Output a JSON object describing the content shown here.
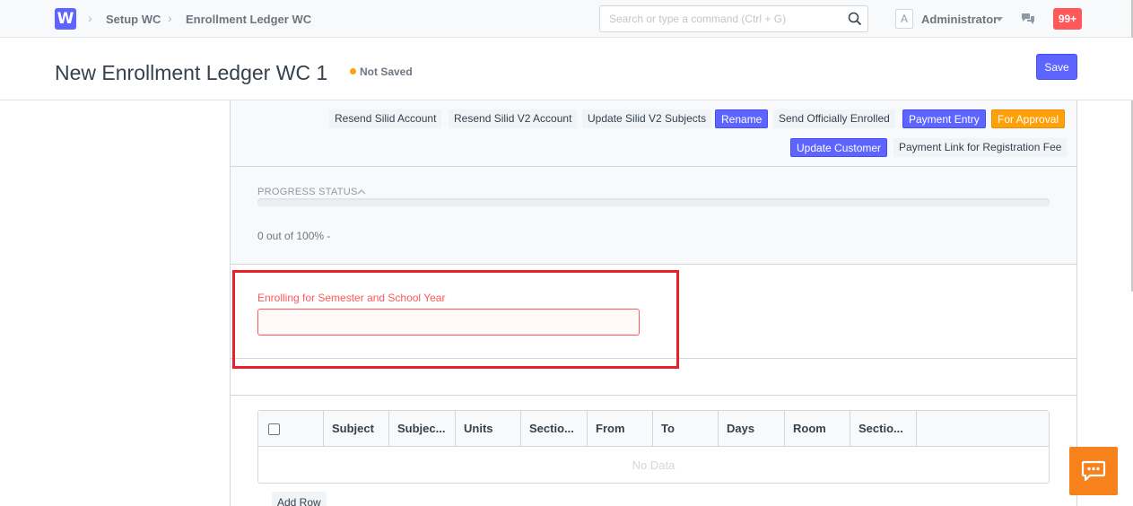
{
  "navbar": {
    "logo_letter": "W",
    "breadcrumbs": [
      "Setup WC",
      "Enrollment Ledger WC"
    ],
    "search_placeholder": "Search or type a command (Ctrl + G)",
    "avatar_letter": "A",
    "user_name": "Administrator",
    "notifications": "99+"
  },
  "page": {
    "title": "New Enrollment Ledger WC 1",
    "status": "Not Saved",
    "save_label": "Save"
  },
  "actions": [
    {
      "label": "Resend Silid Account",
      "style": "default"
    },
    {
      "label": "Resend Silid V2 Account",
      "style": "default"
    },
    {
      "label": "Update Silid V2 Subjects",
      "style": "default"
    },
    {
      "label": "Rename",
      "style": "primary"
    },
    {
      "label": "Send Officially Enrolled",
      "style": "default"
    },
    {
      "label": "Payment Entry",
      "style": "primary"
    },
    {
      "label": "For Approval",
      "style": "warning"
    },
    {
      "label": "Update Customer",
      "style": "primary"
    },
    {
      "label": "Payment Link for Registration Fee",
      "style": "default"
    }
  ],
  "progress": {
    "label": "PROGRESS STATUS",
    "value_percent": 0,
    "text": "0 out of 100% -"
  },
  "semester_field": {
    "label": "Enrolling for Semester and School Year",
    "value": ""
  },
  "table": {
    "columns": [
      "Subject",
      "Subjec...",
      "Units",
      "Sectio...",
      "From",
      "To",
      "Days",
      "Room",
      "Sectio..."
    ],
    "empty_text": "No Data",
    "add_row_label": "Add Row"
  },
  "colors": {
    "primary": "#5e64ff",
    "warning": "#ffa00a",
    "danger": "#ff5858",
    "chat_widget": "#f7821b"
  }
}
